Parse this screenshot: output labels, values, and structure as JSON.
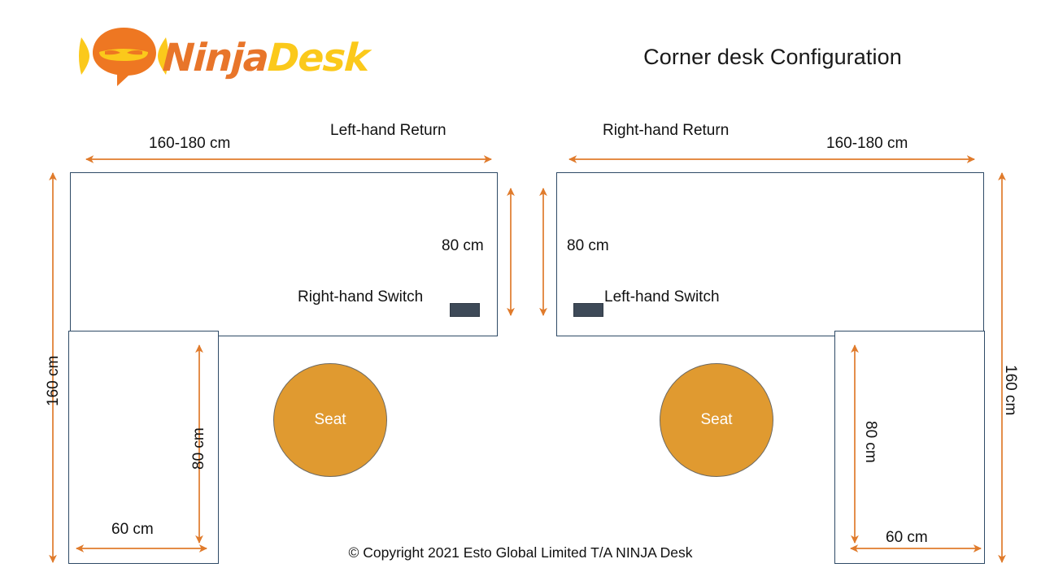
{
  "brand": {
    "logo_icon": "ninja-head-speech-bubble-icon",
    "name_part1": "Ninja",
    "name_part2": "Desk",
    "color_orange": "#E8752A",
    "color_yellow": "#FBC91B"
  },
  "header": {
    "title": "Corner desk Configuration"
  },
  "colors": {
    "desk_outline": "#2E4A66",
    "dimension_arrow": "#E07B2C",
    "seat_fill": "#E09A30",
    "seat_border": "#6E6A62",
    "switch_fill": "#3E4A58",
    "text": "#111111"
  },
  "diagrams": [
    {
      "id": "left-hand-return",
      "title": "Left-hand Return",
      "switch_label": "Right-hand Switch",
      "seat_label": "Seat",
      "dimensions": {
        "top_width": "160-180 cm",
        "top_depth": "80 cm",
        "overall_height": "160 cm",
        "return_depth": "80 cm",
        "return_width": "60 cm"
      }
    },
    {
      "id": "right-hand-return",
      "title": "Right-hand Return",
      "switch_label": "Left-hand Switch",
      "seat_label": "Seat",
      "dimensions": {
        "top_width": "160-180 cm",
        "top_depth": "80 cm",
        "overall_height": "160 cm",
        "return_depth": "80 cm",
        "return_width": "60 cm"
      }
    }
  ],
  "footer": {
    "copyright": "© Copyright 2021 Esto Global Limited T/A NINJA Desk"
  }
}
